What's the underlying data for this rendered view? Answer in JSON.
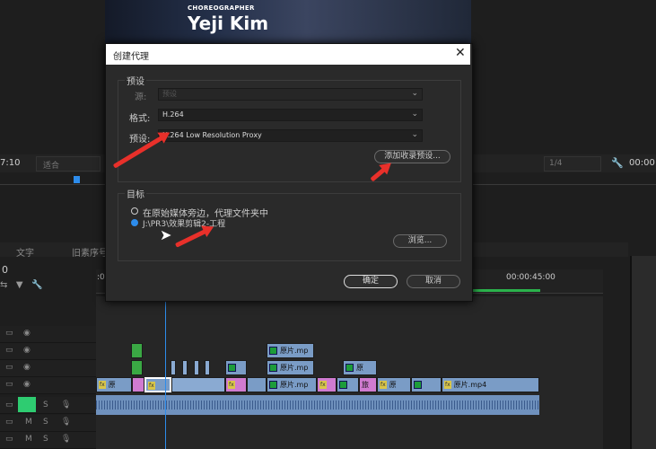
{
  "preview": {
    "credit_role": "CHOREOGRAPHER",
    "credit_name": "Yeji Kim"
  },
  "monitor": {
    "timecode_left": "7:10",
    "fit_label": "适合",
    "resolution_label": "1/4",
    "timecode_right": "00:00:"
  },
  "timeline": {
    "tabs": [
      "文字",
      "旧素序号"
    ],
    "current_time": "0",
    "ruler_start": ":00",
    "ruler_mark": "00:00:45:00",
    "clips": {
      "source_mp": "原片.mp",
      "source_short": "原",
      "source_mp4": "原片.mp4",
      "fx": "fx",
      "fx_pink": "原",
      "fx_pink2": "旅"
    },
    "track_icons": [
      "video-track-icon",
      "eye-icon",
      "mute-icon",
      "solo-icon",
      "mic-icon"
    ]
  },
  "dialog": {
    "title": "创建代理",
    "close_glyph": "✕",
    "preset_group": "预设",
    "source_label": "源:",
    "source_value": "预设",
    "format_label": "格式:",
    "format_value": "H.264",
    "preset_label": "预设:",
    "preset_value": "H.264 Low Resolution Proxy",
    "add_ingest_preset_button": "添加收录预设...",
    "destination_group": "目标",
    "option_next_to_media": "在原始媒体旁边，代理文件夹中",
    "option_path": "J:\\PR3\\效果剪辑2-工程",
    "browse_button": "浏览...",
    "ok_button": "确定",
    "cancel_button": "取消"
  },
  "colors": {
    "accent_blue": "#2d8ceb",
    "annotation_red": "#e8302a",
    "timeline_green": "#2bb24c"
  }
}
